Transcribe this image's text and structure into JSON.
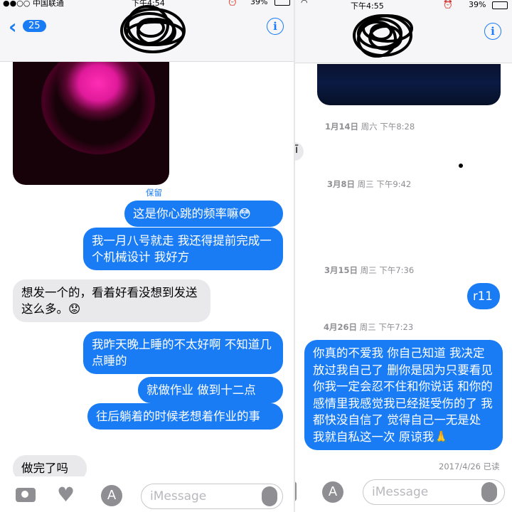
{
  "left": {
    "status": {
      "carrier": "●●○○ 中国联通",
      "time": "下午4:54",
      "battery": "39%"
    },
    "nav": {
      "back_count": "25",
      "info": "i"
    },
    "saved_label": "保留",
    "messages": [
      {
        "dir": "out",
        "text": "这是你心跳的频率嘛😳"
      },
      {
        "dir": "out",
        "text": "我一月八号就走 我还得提前完成一个机械设计 我好方"
      },
      {
        "dir": "in",
        "text": "想发一个的，看着好看没想到发送这么多。😟"
      },
      {
        "dir": "out",
        "text": "我昨天晚上睡的不太好啊 不知道几点睡的"
      },
      {
        "dir": "out",
        "text": "就做作业 做到十二点"
      },
      {
        "dir": "out",
        "text": "往后躺着的时候老想着作业的事"
      },
      {
        "dir": "in",
        "text": "做完了吗"
      }
    ],
    "input_placeholder": "iMessage"
  },
  "right": {
    "status": {
      "time": "下午4:55",
      "battery": "39%"
    },
    "nav": {
      "info": "i"
    },
    "timestamps": [
      {
        "date": "1月14日",
        "rest": "周六 下午8:28"
      },
      {
        "date": "3月8日",
        "rest": "周三 下午9:42"
      },
      {
        "date": "3月15日",
        "rest": "周三 下午7:36"
      },
      {
        "date": "4月26日",
        "rest": "周三 下午7:23"
      }
    ],
    "partial_text": "ī",
    "messages": [
      {
        "dir": "out",
        "text": "r11"
      },
      {
        "dir": "out",
        "text": "你真的不爱我 你自己知道 我决定放过我自己了 删你是因为只要看见你我一定会忍不住和你说话 和你的感情里我感觉我已经挺受伤的了 我都快没自信了 觉得自己一无是处 我就自私这一次 原谅我🙏"
      }
    ],
    "read_receipt": "2017/4/26 已读",
    "input_placeholder": "iMessage"
  },
  "colors": {
    "sent_bubble": "#1a7cf5",
    "received_bubble": "#e9e9eb",
    "accent": "#1a7cf5"
  }
}
